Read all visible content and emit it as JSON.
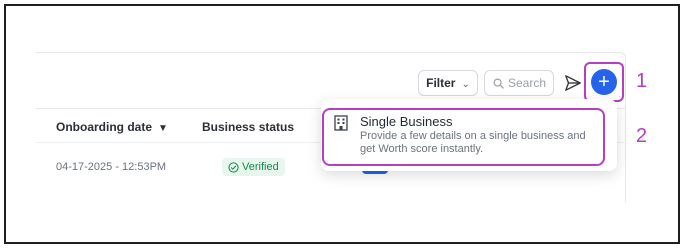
{
  "toolbar": {
    "filter_label": "Filter",
    "search_placeholder": "Search"
  },
  "annotations": {
    "step1": "1",
    "step2": "2"
  },
  "table": {
    "headers": {
      "onboarding_date": "Onboarding date",
      "business_status": "Business status"
    },
    "rows": [
      {
        "onboarding_date": "04-17-2025 - 12:53PM",
        "business_status": "Verified"
      }
    ]
  },
  "dropdown": {
    "items": [
      {
        "title": "Single Business",
        "description": "Provide a few details on a single business and get Worth score instantly.",
        "icon": "building-icon"
      }
    ]
  },
  "colors": {
    "accent_blue": "#2563eb",
    "highlight_purple": "#b43fc3",
    "verified_green": "#16884a"
  }
}
